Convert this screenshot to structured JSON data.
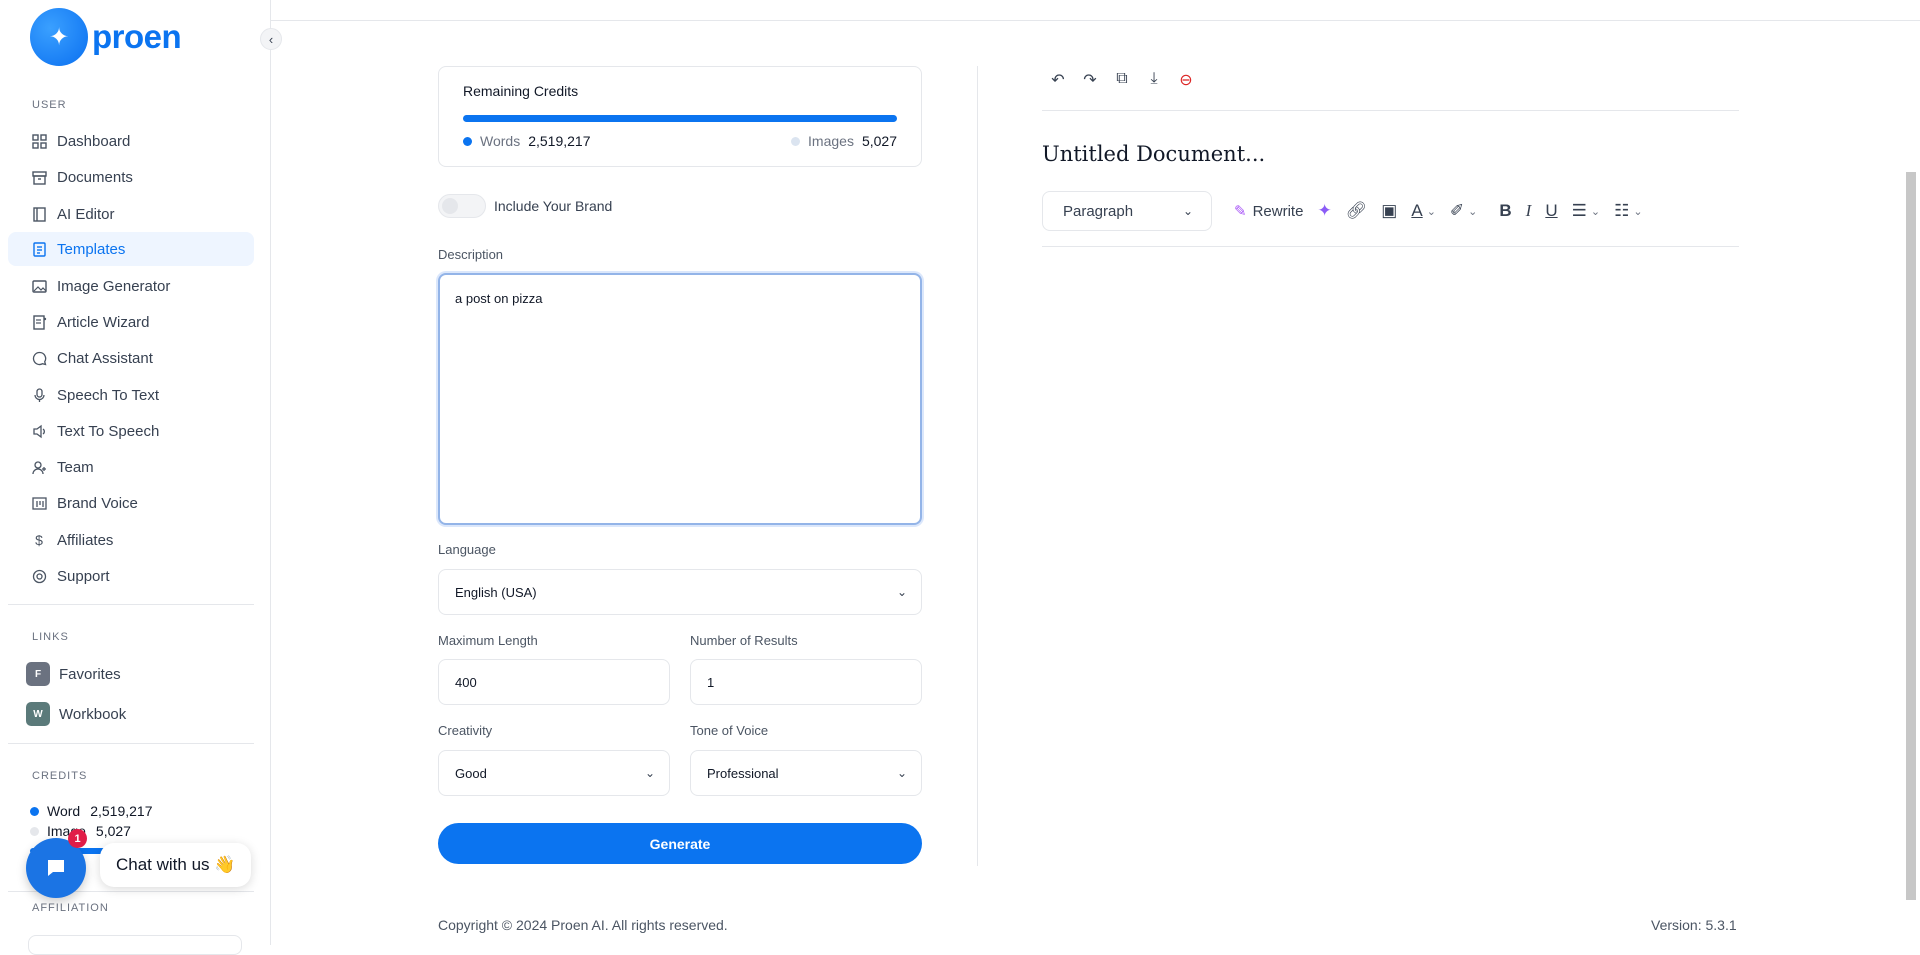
{
  "brand": {
    "name": "proen"
  },
  "sidebar": {
    "user_label": "USER",
    "items": [
      {
        "label": "Dashboard",
        "icon": "grid-icon"
      },
      {
        "label": "Documents",
        "icon": "archive-icon"
      },
      {
        "label": "AI Editor",
        "icon": "editor-icon"
      },
      {
        "label": "Templates",
        "icon": "template-icon",
        "active": true
      },
      {
        "label": "Image Generator",
        "icon": "image-icon"
      },
      {
        "label": "Article Wizard",
        "icon": "article-icon"
      },
      {
        "label": "Chat Assistant",
        "icon": "chat-icon"
      },
      {
        "label": "Speech To Text",
        "icon": "microphone-icon"
      },
      {
        "label": "Text To Speech",
        "icon": "speaker-icon"
      },
      {
        "label": "Team",
        "icon": "user-plus-icon"
      },
      {
        "label": "Brand Voice",
        "icon": "brand-icon"
      },
      {
        "label": "Affiliates",
        "icon": "dollar-icon"
      },
      {
        "label": "Support",
        "icon": "lifebuoy-icon"
      }
    ],
    "links_label": "LINKS",
    "links": [
      {
        "badge": "F",
        "label": "Favorites",
        "color": "#6b7280"
      },
      {
        "badge": "W",
        "label": "Workbook",
        "color": "#5b7a7a"
      }
    ],
    "credits_label": "CREDITS",
    "credits": {
      "word_label": "Word",
      "word_value": "2,519,217",
      "image_label": "Image",
      "image_value": "5,027"
    },
    "affiliation_label": "AFFILIATION"
  },
  "chat": {
    "badge": "1",
    "label": "Chat with us 👋"
  },
  "credits_card": {
    "title": "Remaining Credits",
    "words_label": "Words",
    "words_value": "2,519,217",
    "images_label": "Images",
    "images_value": "5,027"
  },
  "form": {
    "brand_toggle_label": "Include Your Brand",
    "description_label": "Description",
    "description_value": "a post on pizza",
    "language_label": "Language",
    "language_value": "English (USA)",
    "max_length_label": "Maximum Length",
    "max_length_value": "400",
    "results_label": "Number of Results",
    "results_value": "1",
    "creativity_label": "Creativity",
    "creativity_value": "Good",
    "tone_label": "Tone of Voice",
    "tone_value": "Professional",
    "generate_label": "Generate"
  },
  "editor": {
    "doc_title": "Untitled Document...",
    "paragraph_value": "Paragraph",
    "rewrite_label": "Rewrite"
  },
  "footer": {
    "copyright": "Copyright © 2024 Proen AI. All rights reserved.",
    "version": "Version: 5.3.1"
  },
  "colors": {
    "accent": "#0b74f0",
    "active_bg": "#eef5ff"
  }
}
